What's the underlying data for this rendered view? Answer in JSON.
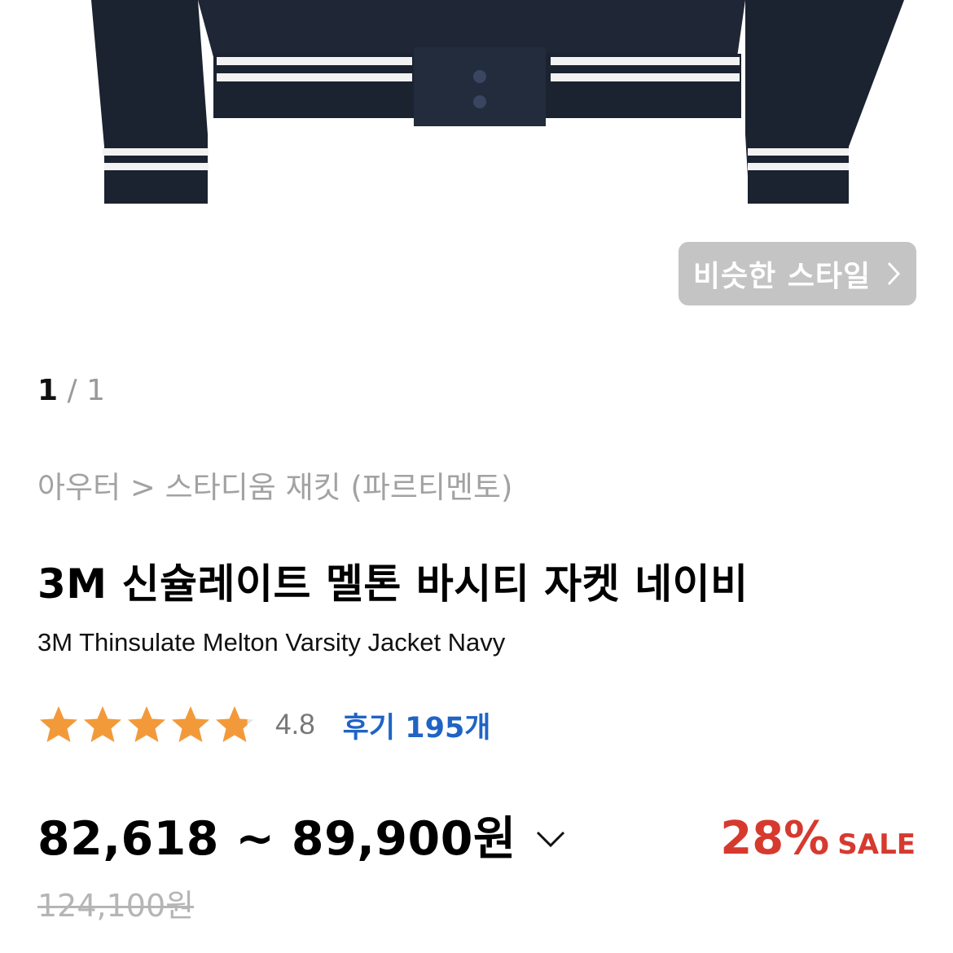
{
  "similar_style_button": {
    "label": "비슷한 스타일"
  },
  "pager": {
    "current": "1",
    "separator": "/",
    "total": "1"
  },
  "breadcrumb": "아우터 > 스타디움 재킷 (파르티멘토)",
  "product": {
    "title": "3M 신슐레이트 멜톤 바시티 자켓 네이비",
    "subtitle": "3M Thinsulate Melton Varsity Jacket Navy"
  },
  "rating": {
    "score": "4.8",
    "stars": 4.8,
    "review_link": "후기 195개"
  },
  "price": {
    "range": "82,618 ~ 89,900원",
    "original": "124,100원",
    "discount_percent": "28%",
    "discount_label": "SALE"
  },
  "colors": {
    "accent_blue": "#1f64c5",
    "sale_red": "#d63a2f",
    "star_orange": "#f29a3a",
    "jacket_navy": "#1b2230"
  }
}
